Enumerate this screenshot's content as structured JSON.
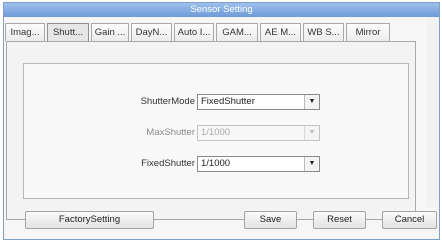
{
  "window": {
    "title": "Sensor Setting"
  },
  "tabs": [
    {
      "label": "Imag..."
    },
    {
      "label": "Shutt..."
    },
    {
      "label": "Gain ..."
    },
    {
      "label": "DayN..."
    },
    {
      "label": "Auto I..."
    },
    {
      "label": "GAM..."
    },
    {
      "label": "AE M..."
    },
    {
      "label": "WB S..."
    },
    {
      "label": "Mirror"
    }
  ],
  "active_tab": "Shutt...",
  "form": {
    "shutter_mode": {
      "label": "ShutterMode",
      "value": "FixedShutter"
    },
    "max_shutter": {
      "label": "MaxShutter",
      "value": "1/1000",
      "enabled": false
    },
    "fixed_shutter": {
      "label": "FixedShutter",
      "value": "1/1000"
    }
  },
  "buttons": {
    "factory": "FactorySetting",
    "save": "Save",
    "reset": "Reset",
    "cancel": "Cancel"
  }
}
